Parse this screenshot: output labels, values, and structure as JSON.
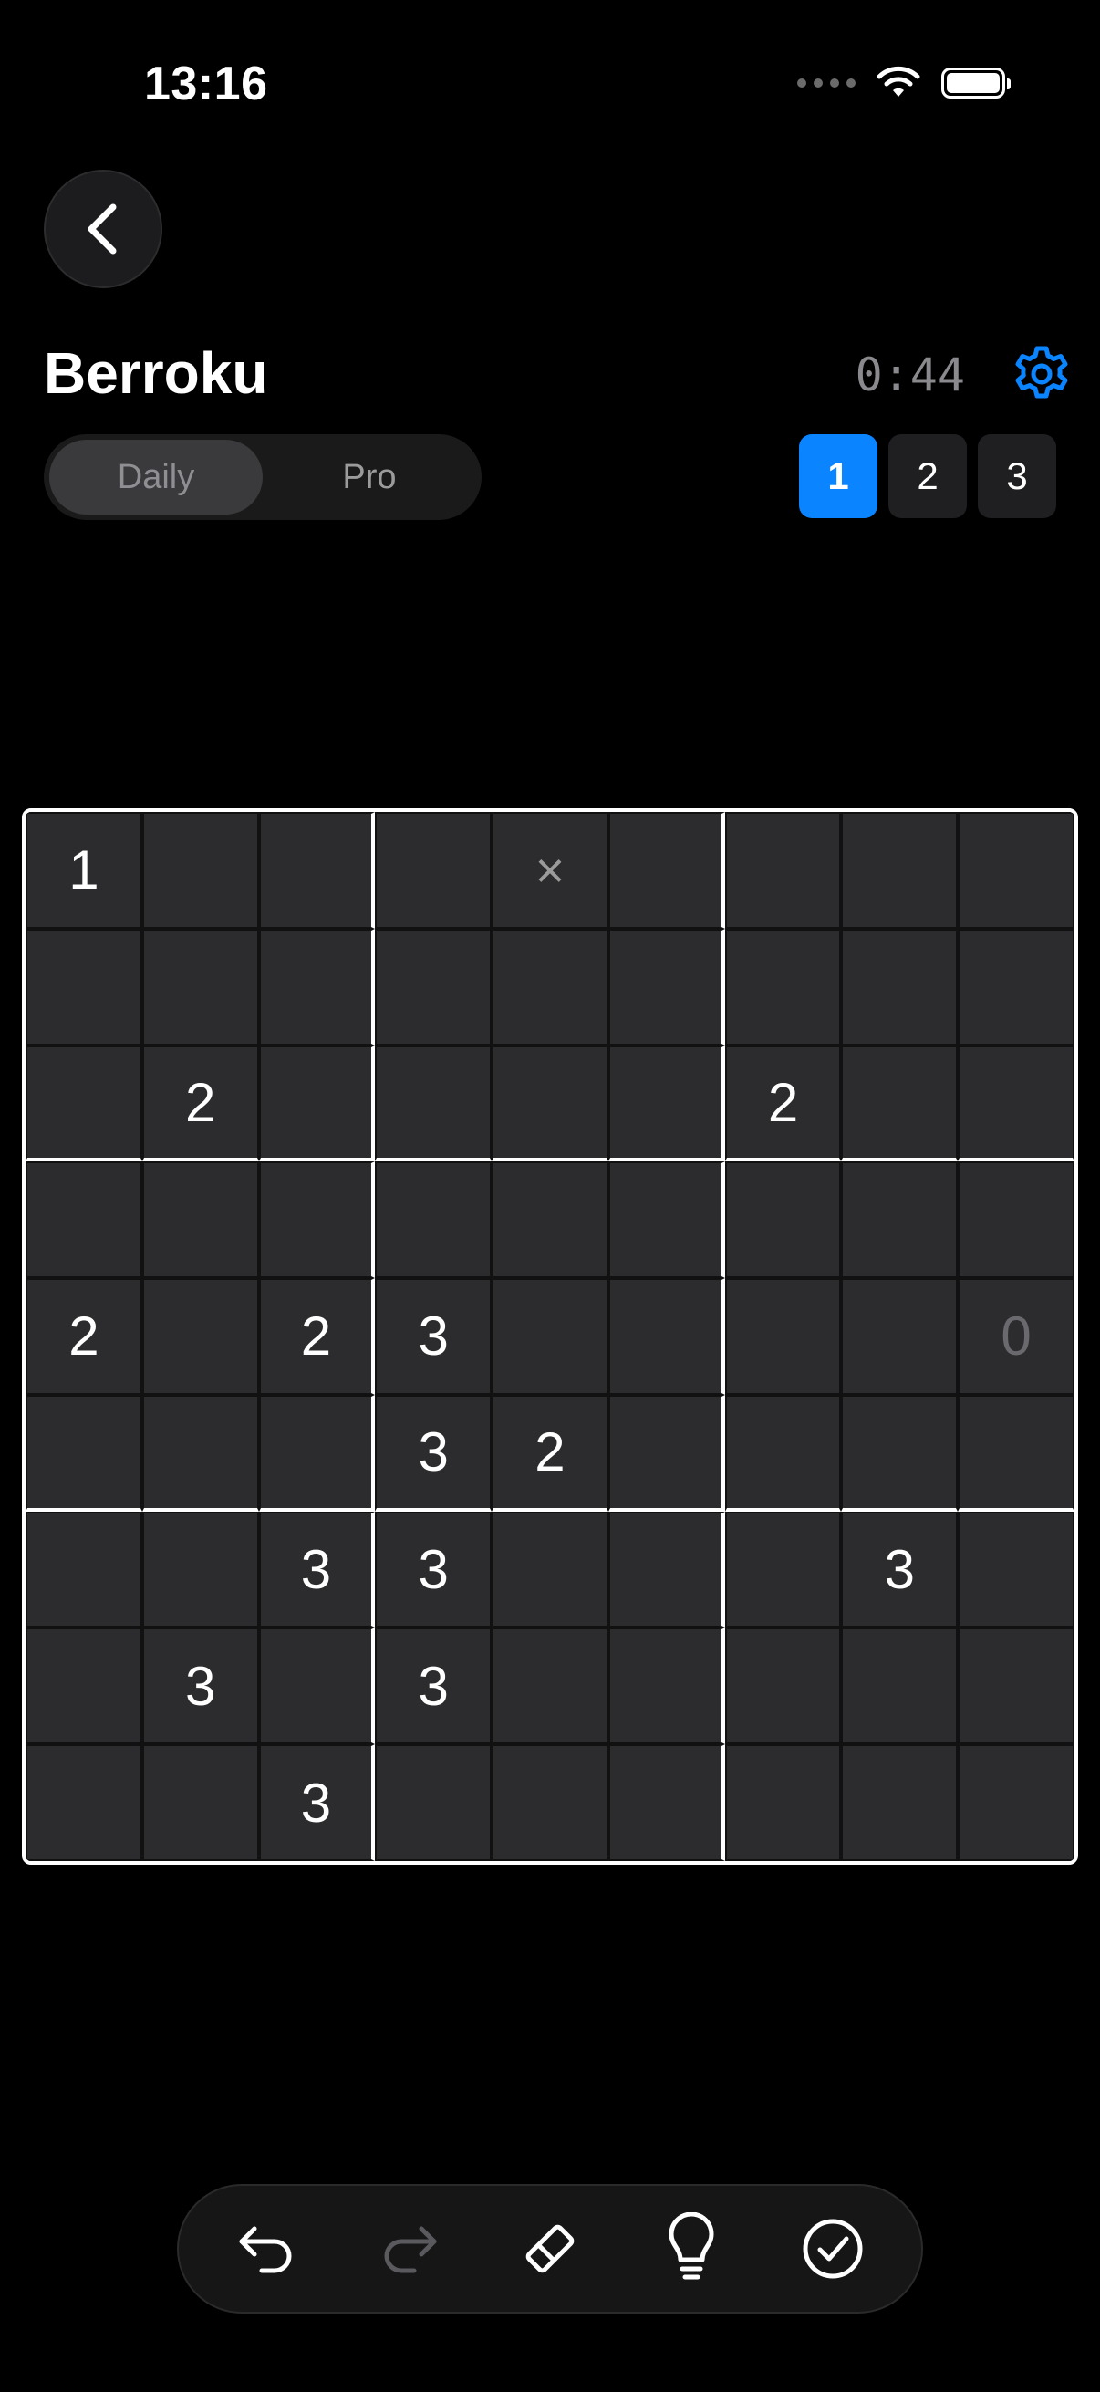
{
  "status": {
    "time": "13:16"
  },
  "header": {
    "title": "Berroku",
    "timer": "0:44"
  },
  "segments": [
    {
      "label": "Daily",
      "active": true
    },
    {
      "label": "Pro",
      "active": false
    }
  ],
  "levels": [
    {
      "label": "1",
      "active": true
    },
    {
      "label": "2",
      "active": false
    },
    {
      "label": "3",
      "active": false
    }
  ],
  "colors": {
    "accent": "#0a84ff",
    "cell": "#2c2c2e",
    "background": "#000000"
  },
  "grid": [
    [
      "1",
      "",
      "",
      "",
      "×",
      "",
      "",
      "",
      ""
    ],
    [
      "",
      "",
      "",
      "",
      "",
      "",
      "",
      "",
      ""
    ],
    [
      "",
      "2",
      "",
      "",
      "",
      "",
      "2",
      "",
      ""
    ],
    [
      "",
      "",
      "",
      "",
      "",
      "",
      "",
      "",
      ""
    ],
    [
      "2",
      "",
      "2",
      "3",
      "",
      "",
      "",
      "",
      "0"
    ],
    [
      "",
      "",
      "",
      "3",
      "2",
      "",
      "",
      "",
      ""
    ],
    [
      "",
      "",
      "3",
      "3",
      "",
      "",
      "",
      "3",
      ""
    ],
    [
      "",
      "3",
      "",
      "3",
      "",
      "",
      "",
      "",
      ""
    ],
    [
      "",
      "",
      "3",
      "",
      "",
      "",
      "",
      "",
      ""
    ]
  ],
  "dim_cells": [
    [
      4,
      8
    ]
  ],
  "toolbar": [
    "undo-icon",
    "redo-icon",
    "eraser-icon",
    "lightbulb-icon",
    "checkmark-circle-icon"
  ]
}
